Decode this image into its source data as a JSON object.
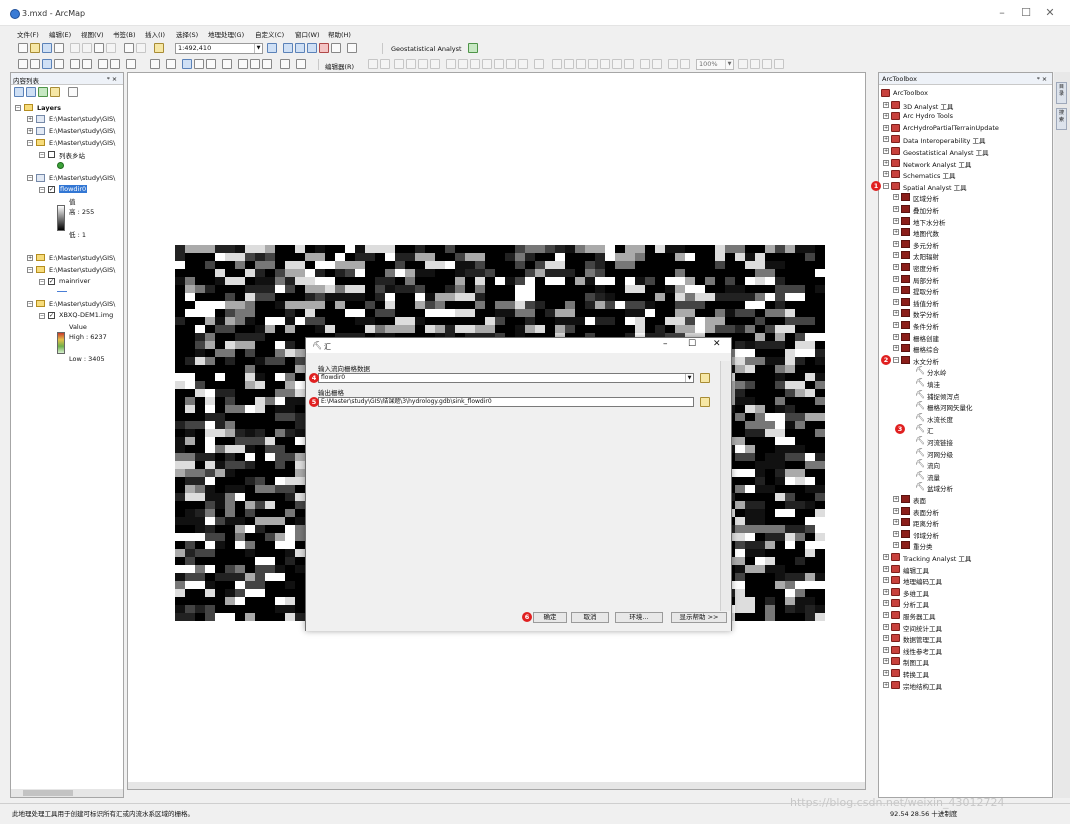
{
  "window": {
    "title": "3.mxd - ArcMap"
  },
  "menu": [
    "文件(F)",
    "编辑(E)",
    "视图(V)",
    "书签(B)",
    "插入(I)",
    "选择(S)",
    "地理处理(G)",
    "自定义(C)",
    "窗口(W)",
    "帮助(H)"
  ],
  "toolbar": {
    "scale": "1:492,410",
    "geostat_label": "Geostatistical Analyst",
    "editor_label": "编辑器(R)",
    "zoom_value": "100%"
  },
  "toc": {
    "title": "内容列表",
    "pin": "ᵠ ×",
    "root": "Layers",
    "rows": [
      {
        "label": "E:\\Master\\study\\GIS\\"
      },
      {
        "label": "E:\\Master\\study\\GIS\\"
      },
      {
        "label": "E:\\Master\\study\\GIS\\"
      },
      {
        "label": "列表乡站"
      },
      {
        "label": "E:\\Master\\study\\GIS\\"
      },
      {
        "label": "flowdir0"
      },
      {
        "label": "值"
      },
      {
        "label": "高 : 255"
      },
      {
        "label": "低 : 1"
      },
      {
        "label": "E:\\Master\\study\\GIS\\"
      },
      {
        "label": "E:\\Master\\study\\GIS\\"
      },
      {
        "label": "mainriver"
      },
      {
        "label": "E:\\Master\\study\\GIS\\"
      },
      {
        "label": "XBXQ-DEM1.img"
      },
      {
        "label": "Value"
      },
      {
        "label": "High : 6237"
      },
      {
        "label": "Low : 3405"
      }
    ]
  },
  "dialog": {
    "title": "汇",
    "input_label": "输入流向栅格数据",
    "input_value": "flowdir0",
    "output_label": "输出栅格",
    "output_value": "E:\\Master\\study\\GIS\\结课题\\3\\hydrology.gdb\\sink_flowdir0",
    "ok": "确定",
    "cancel": "取消",
    "env": "环境...",
    "help": "显示帮助 >>",
    "badges": [
      "4",
      "5",
      "6"
    ]
  },
  "toolbox": {
    "title": "ArcToolbox",
    "pin": "ᵠ ×",
    "root": "ArcToolbox",
    "items": [
      "3D Analyst 工具",
      "Arc Hydro Tools",
      "ArcHydroPartialTerrainUpdate",
      "Data Interoperability 工具",
      "Geostatistical Analyst 工具",
      "Network Analyst 工具",
      "Schematics 工具",
      "Spatial Analyst 工具"
    ],
    "spatial_sets": [
      "区域分析",
      "叠加分析",
      "地下水分析",
      "地图代数",
      "多元分析",
      "太阳辐射",
      "密度分析",
      "局部分析",
      "提取分析",
      "插值分析",
      "数学分析",
      "条件分析",
      "栅格创建",
      "栅格综合",
      "水文分析"
    ],
    "hydro_tools": [
      "分水岭",
      "填洼",
      "捕捉倾泻点",
      "栅格河网矢量化",
      "水流长度",
      "汇",
      "河流链接",
      "河网分级",
      "流向",
      "流量",
      "盆域分析"
    ],
    "after_sets": [
      "表面",
      "表面分析",
      "距离分析",
      "邻域分析",
      "重分类"
    ],
    "more": [
      "Tracking Analyst 工具",
      "编辑工具",
      "地理编码工具",
      "多维工具",
      "分析工具",
      "服务器工具",
      "空间统计工具",
      "数据管理工具",
      "线性参考工具",
      "制图工具",
      "转换工具",
      "宗地结构工具"
    ],
    "badges": [
      "1",
      "2",
      "3"
    ]
  },
  "dock_tabs": [
    "目录",
    "搜索"
  ],
  "status": {
    "message": "此地理处理工具用于创建可标识所有汇或内流水系区域的栅格。",
    "coords": "92.54  28.56  十进制度",
    "watermark": "https://blog.csdn.net/weixin_43012724"
  }
}
